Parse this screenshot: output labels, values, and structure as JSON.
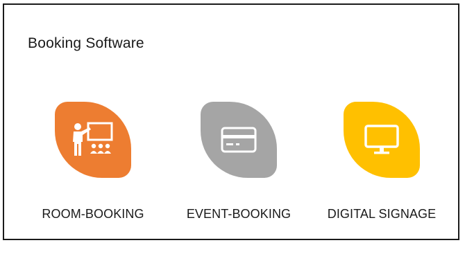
{
  "page": {
    "title": "Booking Software"
  },
  "products": [
    {
      "label": "ROOM-BOOKING",
      "icon": "presentation-icon",
      "color": "#ED7D31"
    },
    {
      "label": "EVENT-BOOKING",
      "icon": "credit-card-icon",
      "color": "#A5A5A5"
    },
    {
      "label": "DIGITAL SIGNAGE",
      "icon": "monitor-icon",
      "color": "#FFC000"
    }
  ]
}
